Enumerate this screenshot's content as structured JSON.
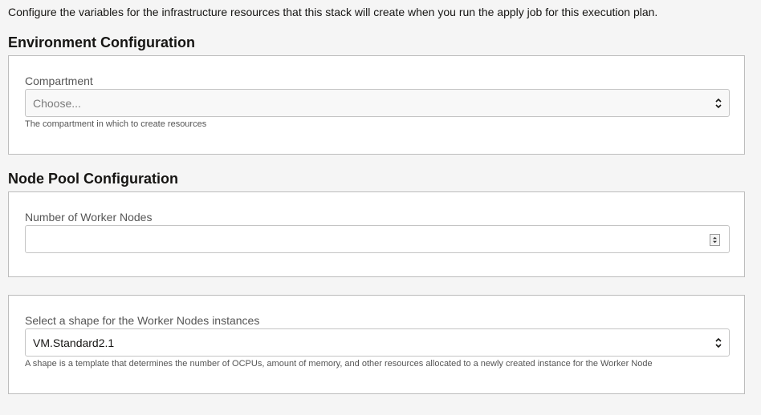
{
  "intro_text": "Configure the variables for the infrastructure resources that this stack will create when you run the apply job for this execution plan.",
  "environment": {
    "title": "Environment Configuration",
    "compartment": {
      "label": "Compartment",
      "placeholder": "Choose...",
      "help": "The compartment in which to create resources",
      "icon": "chevron-up-down-icon"
    }
  },
  "node_pool": {
    "title": "Node Pool Configuration",
    "worker_nodes": {
      "label": "Number of Worker Nodes",
      "value": "",
      "icon": "spinner-icon"
    },
    "shape": {
      "label": "Select a shape for the Worker Nodes instances",
      "value": "VM.Standard2.1",
      "help": "A shape is a template that determines the number of OCPUs, amount of memory, and other resources allocated to a newly created instance for the Worker Node",
      "icon": "chevron-up-down-icon"
    }
  }
}
